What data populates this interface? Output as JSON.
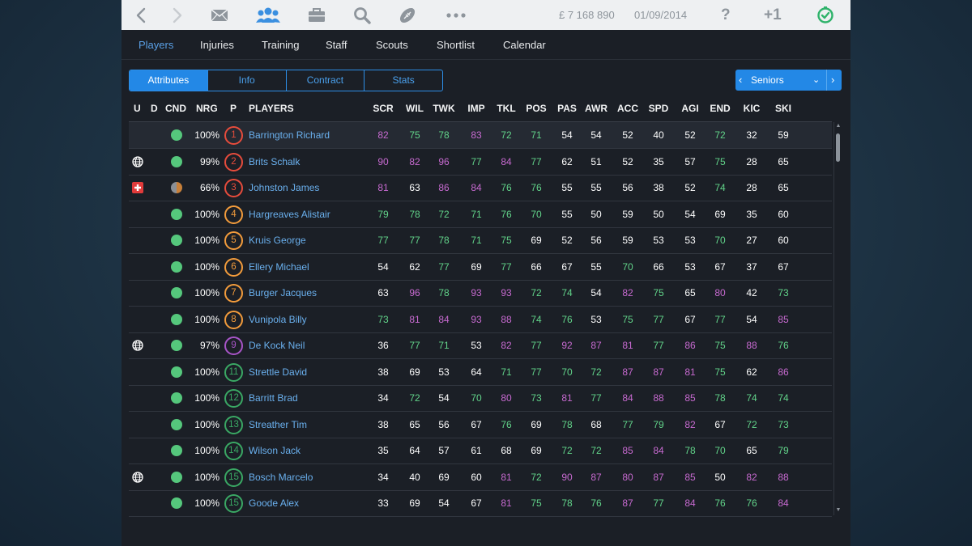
{
  "colors": {
    "accent": "#2388e6",
    "stat_white": "#ffffff",
    "stat_green": "#62d48a",
    "stat_pink": "#c76ad0",
    "cnd_green": "#55c77c",
    "pos_red": "#e74c3c",
    "pos_orange": "#f39c3c",
    "pos_purple": "#a855c8",
    "pos_green": "#3aa864"
  },
  "toolbar": {
    "icons": [
      "back-icon",
      "forward-icon",
      "mail-icon",
      "squad-icon",
      "briefcase-icon",
      "search-icon",
      "rugby-ball-icon",
      "more-icon",
      "help-icon",
      "clock-icon"
    ],
    "money": "£ 7 168 890",
    "date": "01/09/2014",
    "help": "?",
    "plus_one": "+1"
  },
  "nav": {
    "items": [
      "Players",
      "Injuries",
      "Training",
      "Staff",
      "Scouts",
      "Shortlist",
      "Calendar"
    ],
    "active": "Players"
  },
  "view_tabs": {
    "items": [
      "Attributes",
      "Info",
      "Contract",
      "Stats"
    ],
    "active": "Attributes"
  },
  "squad_selector": {
    "label": "Seniors",
    "prev": "‹",
    "next": "›",
    "dropdown": "⌄"
  },
  "table": {
    "headers": [
      "U",
      "D",
      "CND",
      "NRG",
      "P",
      "PLAYERS",
      "SCR",
      "WIL",
      "TWK",
      "IMP",
      "TKL",
      "POS",
      "PAS",
      "AWR",
      "ACC",
      "SPD",
      "AGI",
      "END",
      "KIC",
      "SKI"
    ],
    "rows": [
      {
        "flag": "",
        "cnd": "full",
        "nrg": "100%",
        "pos": "1",
        "pos_color": "red",
        "name": "Barrington Richard",
        "selected": true,
        "stats": [
          [
            82,
            "p"
          ],
          [
            75,
            "g"
          ],
          [
            78,
            "g"
          ],
          [
            83,
            "p"
          ],
          [
            72,
            "g"
          ],
          [
            71,
            "g"
          ],
          [
            54,
            "w"
          ],
          [
            54,
            "w"
          ],
          [
            52,
            "w"
          ],
          [
            40,
            "w"
          ],
          [
            52,
            "w"
          ],
          [
            72,
            "g"
          ],
          [
            32,
            "w"
          ],
          [
            59,
            "w"
          ]
        ]
      },
      {
        "flag": "globe",
        "cnd": "full",
        "nrg": "99%",
        "pos": "2",
        "pos_color": "red",
        "name": "Brits Schalk",
        "stats": [
          [
            90,
            "p"
          ],
          [
            82,
            "p"
          ],
          [
            96,
            "p"
          ],
          [
            77,
            "g"
          ],
          [
            84,
            "p"
          ],
          [
            77,
            "g"
          ],
          [
            62,
            "w"
          ],
          [
            51,
            "w"
          ],
          [
            52,
            "w"
          ],
          [
            35,
            "w"
          ],
          [
            57,
            "w"
          ],
          [
            75,
            "g"
          ],
          [
            28,
            "w"
          ],
          [
            65,
            "w"
          ]
        ]
      },
      {
        "flag": "medical",
        "cnd": "half",
        "nrg": "66%",
        "pos": "3",
        "pos_color": "red",
        "name": "Johnston James",
        "stats": [
          [
            81,
            "p"
          ],
          [
            63,
            "w"
          ],
          [
            86,
            "p"
          ],
          [
            84,
            "p"
          ],
          [
            76,
            "g"
          ],
          [
            76,
            "g"
          ],
          [
            55,
            "w"
          ],
          [
            55,
            "w"
          ],
          [
            56,
            "w"
          ],
          [
            38,
            "w"
          ],
          [
            52,
            "w"
          ],
          [
            74,
            "g"
          ],
          [
            28,
            "w"
          ],
          [
            65,
            "w"
          ]
        ]
      },
      {
        "flag": "",
        "cnd": "full",
        "nrg": "100%",
        "pos": "4",
        "pos_color": "orange",
        "name": "Hargreaves Alistair",
        "stats": [
          [
            79,
            "g"
          ],
          [
            78,
            "g"
          ],
          [
            72,
            "g"
          ],
          [
            71,
            "g"
          ],
          [
            76,
            "g"
          ],
          [
            70,
            "g"
          ],
          [
            55,
            "w"
          ],
          [
            50,
            "w"
          ],
          [
            59,
            "w"
          ],
          [
            50,
            "w"
          ],
          [
            54,
            "w"
          ],
          [
            69,
            "w"
          ],
          [
            35,
            "w"
          ],
          [
            60,
            "w"
          ]
        ]
      },
      {
        "flag": "",
        "cnd": "full",
        "nrg": "100%",
        "pos": "5",
        "pos_color": "orange",
        "name": "Kruis George",
        "stats": [
          [
            77,
            "g"
          ],
          [
            77,
            "g"
          ],
          [
            78,
            "g"
          ],
          [
            71,
            "g"
          ],
          [
            75,
            "g"
          ],
          [
            69,
            "w"
          ],
          [
            52,
            "w"
          ],
          [
            56,
            "w"
          ],
          [
            59,
            "w"
          ],
          [
            53,
            "w"
          ],
          [
            53,
            "w"
          ],
          [
            70,
            "g"
          ],
          [
            27,
            "w"
          ],
          [
            60,
            "w"
          ]
        ]
      },
      {
        "flag": "",
        "cnd": "full",
        "nrg": "100%",
        "pos": "6",
        "pos_color": "orange",
        "name": "Ellery Michael",
        "stats": [
          [
            54,
            "w"
          ],
          [
            62,
            "w"
          ],
          [
            77,
            "g"
          ],
          [
            69,
            "w"
          ],
          [
            77,
            "g"
          ],
          [
            66,
            "w"
          ],
          [
            67,
            "w"
          ],
          [
            55,
            "w"
          ],
          [
            70,
            "g"
          ],
          [
            66,
            "w"
          ],
          [
            53,
            "w"
          ],
          [
            67,
            "w"
          ],
          [
            37,
            "w"
          ],
          [
            67,
            "w"
          ]
        ]
      },
      {
        "flag": "",
        "cnd": "full",
        "nrg": "100%",
        "pos": "7",
        "pos_color": "orange",
        "name": "Burger Jacques",
        "stats": [
          [
            63,
            "w"
          ],
          [
            96,
            "p"
          ],
          [
            78,
            "g"
          ],
          [
            93,
            "p"
          ],
          [
            93,
            "p"
          ],
          [
            72,
            "g"
          ],
          [
            74,
            "g"
          ],
          [
            54,
            "w"
          ],
          [
            82,
            "p"
          ],
          [
            75,
            "g"
          ],
          [
            65,
            "w"
          ],
          [
            80,
            "p"
          ],
          [
            42,
            "w"
          ],
          [
            73,
            "g"
          ]
        ]
      },
      {
        "flag": "",
        "cnd": "full",
        "nrg": "100%",
        "pos": "8",
        "pos_color": "orange",
        "name": "Vunipola Billy",
        "stats": [
          [
            73,
            "g"
          ],
          [
            81,
            "p"
          ],
          [
            84,
            "p"
          ],
          [
            93,
            "p"
          ],
          [
            88,
            "p"
          ],
          [
            74,
            "g"
          ],
          [
            76,
            "g"
          ],
          [
            53,
            "w"
          ],
          [
            75,
            "g"
          ],
          [
            77,
            "g"
          ],
          [
            67,
            "w"
          ],
          [
            77,
            "g"
          ],
          [
            54,
            "w"
          ],
          [
            85,
            "p"
          ]
        ]
      },
      {
        "flag": "globe",
        "cnd": "full",
        "nrg": "97%",
        "pos": "9",
        "pos_color": "purple",
        "name": "De Kock Neil",
        "stats": [
          [
            36,
            "w"
          ],
          [
            77,
            "g"
          ],
          [
            71,
            "g"
          ],
          [
            53,
            "w"
          ],
          [
            82,
            "p"
          ],
          [
            77,
            "g"
          ],
          [
            92,
            "p"
          ],
          [
            87,
            "p"
          ],
          [
            81,
            "p"
          ],
          [
            77,
            "g"
          ],
          [
            86,
            "p"
          ],
          [
            75,
            "g"
          ],
          [
            88,
            "p"
          ],
          [
            76,
            "g"
          ]
        ]
      },
      {
        "flag": "",
        "cnd": "full",
        "nrg": "100%",
        "pos": "11",
        "pos_color": "green",
        "name": "Strettle David",
        "stats": [
          [
            38,
            "w"
          ],
          [
            69,
            "w"
          ],
          [
            53,
            "w"
          ],
          [
            64,
            "w"
          ],
          [
            71,
            "g"
          ],
          [
            77,
            "g"
          ],
          [
            70,
            "g"
          ],
          [
            72,
            "g"
          ],
          [
            87,
            "p"
          ],
          [
            87,
            "p"
          ],
          [
            81,
            "p"
          ],
          [
            75,
            "g"
          ],
          [
            62,
            "w"
          ],
          [
            86,
            "p"
          ]
        ]
      },
      {
        "flag": "",
        "cnd": "full",
        "nrg": "100%",
        "pos": "12",
        "pos_color": "green",
        "name": "Barritt Brad",
        "stats": [
          [
            34,
            "w"
          ],
          [
            72,
            "g"
          ],
          [
            54,
            "w"
          ],
          [
            70,
            "g"
          ],
          [
            80,
            "p"
          ],
          [
            73,
            "g"
          ],
          [
            81,
            "p"
          ],
          [
            77,
            "g"
          ],
          [
            84,
            "p"
          ],
          [
            88,
            "p"
          ],
          [
            85,
            "p"
          ],
          [
            78,
            "g"
          ],
          [
            74,
            "g"
          ],
          [
            74,
            "g"
          ]
        ]
      },
      {
        "flag": "",
        "cnd": "full",
        "nrg": "100%",
        "pos": "13",
        "pos_color": "green",
        "name": "Streather Tim",
        "stats": [
          [
            38,
            "w"
          ],
          [
            65,
            "w"
          ],
          [
            56,
            "w"
          ],
          [
            67,
            "w"
          ],
          [
            76,
            "g"
          ],
          [
            69,
            "w"
          ],
          [
            78,
            "g"
          ],
          [
            68,
            "w"
          ],
          [
            77,
            "g"
          ],
          [
            79,
            "g"
          ],
          [
            82,
            "p"
          ],
          [
            67,
            "w"
          ],
          [
            72,
            "g"
          ],
          [
            73,
            "g"
          ]
        ]
      },
      {
        "flag": "",
        "cnd": "full",
        "nrg": "100%",
        "pos": "14",
        "pos_color": "green",
        "name": "Wilson Jack",
        "stats": [
          [
            35,
            "w"
          ],
          [
            64,
            "w"
          ],
          [
            57,
            "w"
          ],
          [
            61,
            "w"
          ],
          [
            68,
            "w"
          ],
          [
            69,
            "w"
          ],
          [
            72,
            "g"
          ],
          [
            72,
            "g"
          ],
          [
            85,
            "p"
          ],
          [
            84,
            "p"
          ],
          [
            78,
            "g"
          ],
          [
            70,
            "g"
          ],
          [
            65,
            "w"
          ],
          [
            79,
            "g"
          ]
        ]
      },
      {
        "flag": "globe",
        "cnd": "full",
        "nrg": "100%",
        "pos": "15",
        "pos_color": "green",
        "name": "Bosch Marcelo",
        "stats": [
          [
            34,
            "w"
          ],
          [
            40,
            "w"
          ],
          [
            69,
            "w"
          ],
          [
            60,
            "w"
          ],
          [
            81,
            "p"
          ],
          [
            72,
            "g"
          ],
          [
            90,
            "p"
          ],
          [
            87,
            "p"
          ],
          [
            80,
            "p"
          ],
          [
            87,
            "p"
          ],
          [
            85,
            "p"
          ],
          [
            50,
            "w"
          ],
          [
            82,
            "p"
          ],
          [
            88,
            "p"
          ]
        ]
      },
      {
        "flag": "",
        "cnd": "full",
        "nrg": "100%",
        "pos": "15",
        "pos_color": "green",
        "name": "Goode Alex",
        "stats": [
          [
            33,
            "w"
          ],
          [
            69,
            "w"
          ],
          [
            54,
            "w"
          ],
          [
            67,
            "w"
          ],
          [
            81,
            "p"
          ],
          [
            75,
            "g"
          ],
          [
            78,
            "g"
          ],
          [
            76,
            "g"
          ],
          [
            87,
            "p"
          ],
          [
            77,
            "g"
          ],
          [
            84,
            "p"
          ],
          [
            76,
            "g"
          ],
          [
            76,
            "g"
          ],
          [
            84,
            "p"
          ]
        ]
      }
    ]
  }
}
